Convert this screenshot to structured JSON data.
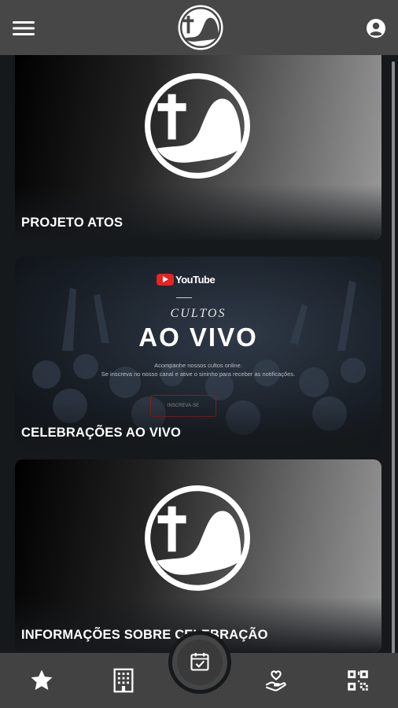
{
  "header": {
    "menu_icon": "hamburger-menu-icon",
    "logo_icon": "church-cross-mountain-logo",
    "account_icon": "account-circle-icon"
  },
  "cards": [
    {
      "title": "PROJETO ATOS",
      "image": "church-logo"
    },
    {
      "title": "CELEBRAÇÕES AO VIVO",
      "image": {
        "brand": "YouTube",
        "subtitle": "CULTOS",
        "headline": "AO VIVO",
        "line1": "Acompanhe nossos cultos online.",
        "line2": "Se inscreva no nosso canal e ative o sininho para receber as notificações.",
        "button": "INSCREVA-SE"
      }
    },
    {
      "title": "INFORMAÇÕES SOBRE CELEBRAÇÃO",
      "image": "church-logo"
    }
  ],
  "bottom_nav": [
    {
      "icon": "star-icon"
    },
    {
      "icon": "building-icon"
    },
    {
      "icon": "calendar-check-icon"
    },
    {
      "icon": "hand-heart-icon"
    },
    {
      "icon": "qr-code-icon"
    }
  ],
  "colors": {
    "header": "#474747",
    "background": "#15191c",
    "nav": "#424242",
    "youtube_red": "#e32524"
  }
}
